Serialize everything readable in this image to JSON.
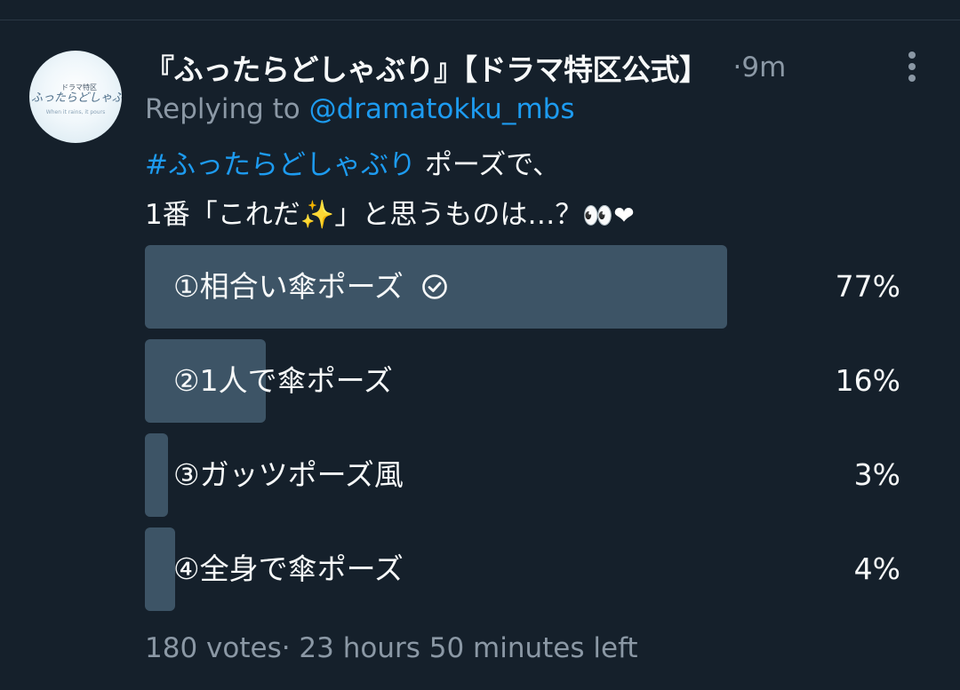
{
  "tweet": {
    "display_name": "『ふったらどしゃぶり』【ドラマ特区公式】",
    "time_separator": "·",
    "time": "9m",
    "replying_prefix": "Replying to ",
    "replying_handle": "@dramatokku_mbs",
    "text_line1_hashtag": "#ふったらどしゃぶり",
    "text_line1_rest": " ポーズで、",
    "text_line2_start": "1番「これだ",
    "text_line2_sparkle": "✨",
    "text_line2_end": "」と思うものは…？",
    "text_line2_eyes": "👀",
    "text_line2_heart": "❤"
  },
  "avatar": {
    "badge": "ドラマ特区",
    "script": "ふったらどしゃぶり",
    "sub": "When it rains, it pours"
  },
  "poll": {
    "options": [
      {
        "label": "①相合い傘ポーズ",
        "percent_label": "77%",
        "percent": 77,
        "selected": true
      },
      {
        "label": "②1人で傘ポーズ",
        "percent_label": "16%",
        "percent": 16,
        "selected": false
      },
      {
        "label": "③ガッツポーズ風",
        "percent_label": "3%",
        "percent": 3,
        "selected": false
      },
      {
        "label": "④全身で傘ポーズ",
        "percent_label": "4%",
        "percent": 4,
        "selected": false
      }
    ],
    "votes": "180 votes",
    "footer_sep": "·",
    "time_left": "23 hours 50 minutes left"
  },
  "colors": {
    "background": "#15202b",
    "bar_winner": "#3d5466",
    "bar_other": "#3d5466",
    "accent": "#1d9bf0",
    "secondary_text": "#8b98a5"
  },
  "icons": {
    "more": "more-vertical-icon",
    "check": "check-circle-icon"
  }
}
